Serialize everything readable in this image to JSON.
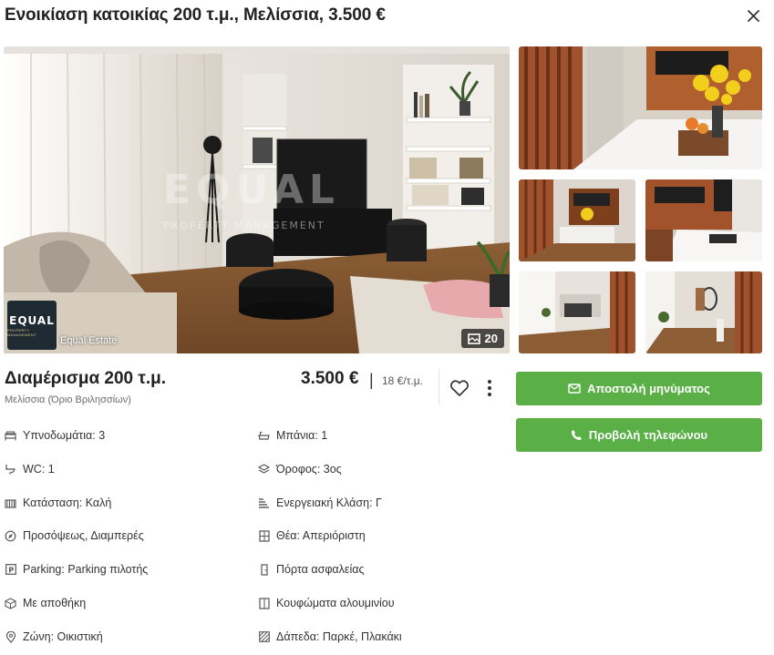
{
  "header": {
    "title": "Ενοικίαση κατοικίας 200 τ.μ., Μελίσσια, 3.500 €"
  },
  "gallery": {
    "watermark_text": "EQUAL",
    "watermark_sub": "PROPERTY MANAGEMENT",
    "agency_logo_text": "EQUAL",
    "agency_logo_sub": "PROPERTY MANAGEMENT",
    "agency_name": "Equal Estate",
    "photo_count": "20"
  },
  "listing": {
    "property_type": "Διαμέρισμα 200 τ.μ.",
    "location": "Μελίσσια (Όριο Βριλησσίων)",
    "price": "3.500 €",
    "separator": "|",
    "price_per_sqm": "18 €/τ.μ."
  },
  "actions": {
    "message_label": "Αποστολή μηνύματος",
    "phone_label": "Προβολή τηλεφώνου"
  },
  "features": [
    {
      "icon": "bed-icon",
      "label": "Υπνοδωμάτια: 3"
    },
    {
      "icon": "bathtub-icon",
      "label": "Μπάνια: 1"
    },
    {
      "icon": "toilet-icon",
      "label": "WC: 1"
    },
    {
      "icon": "layers-icon",
      "label": "Όροφος: 3ος"
    },
    {
      "icon": "condition-icon",
      "label": "Κατάσταση: Καλή"
    },
    {
      "icon": "energy-class-icon",
      "label": "Ενεργειακή Κλάση: Γ"
    },
    {
      "icon": "compass-icon",
      "label": "Προσόψεως, Διαμπερές"
    },
    {
      "icon": "window-view-icon",
      "label": "Θέα: Απεριόριστη"
    },
    {
      "icon": "parking-icon",
      "label": "Parking: Parking πιλοτής"
    },
    {
      "icon": "door-icon",
      "label": "Πόρτα ασφαλείας"
    },
    {
      "icon": "box-icon",
      "label": "Με αποθήκη"
    },
    {
      "icon": "window-frame-icon",
      "label": "Κουφώματα αλουμινίου"
    },
    {
      "icon": "location-pin-icon",
      "label": "Ζώνη: Οικιστική"
    },
    {
      "icon": "floor-pattern-icon",
      "label": "Δάπεδα: Παρκέ, Πλακάκι"
    }
  ],
  "colors": {
    "accent_green": "#5aaf46",
    "text_dark": "#222222",
    "text_muted": "#6b6b6b",
    "logo_bg": "#1e2b33"
  }
}
